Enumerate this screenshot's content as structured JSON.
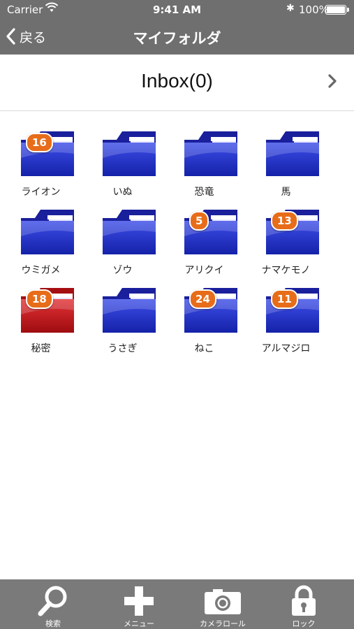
{
  "status_bar": {
    "carrier": "Carrier",
    "time": "9:41 AM",
    "battery": "100%"
  },
  "nav": {
    "back_label": "戻る",
    "title": "マイフォルダ"
  },
  "inbox": {
    "label": "Inbox(0)"
  },
  "folders": [
    {
      "name": "ライオン",
      "badge": "16",
      "color": "blue"
    },
    {
      "name": "いぬ",
      "badge": "",
      "color": "blue"
    },
    {
      "name": "恐竜",
      "badge": "",
      "color": "blue"
    },
    {
      "name": "馬",
      "badge": "",
      "color": "blue"
    },
    {
      "name": "ウミガメ",
      "badge": "",
      "color": "blue"
    },
    {
      "name": "ゾウ",
      "badge": "",
      "color": "blue"
    },
    {
      "name": "アリクイ",
      "badge": "5",
      "color": "blue"
    },
    {
      "name": "ナマケモノ",
      "badge": "13",
      "color": "blue"
    },
    {
      "name": "秘密",
      "badge": "18",
      "color": "red"
    },
    {
      "name": "うさぎ",
      "badge": "",
      "color": "blue"
    },
    {
      "name": "ねこ",
      "badge": "24",
      "color": "blue"
    },
    {
      "name": "アルマジロ",
      "badge": "11",
      "color": "blue"
    }
  ],
  "tabbar": {
    "items": [
      {
        "label": "検索",
        "icon": "search-icon"
      },
      {
        "label": "メニュー",
        "icon": "plus-icon"
      },
      {
        "label": "カメラロール",
        "icon": "camera-icon"
      },
      {
        "label": "ロック",
        "icon": "lock-icon"
      }
    ]
  },
  "colors": {
    "bar_gray": "#6f6f6f",
    "tab_gray": "#7a7a7a",
    "folder_blue": "#1e2fc4",
    "folder_red": "#c4161c",
    "badge_orange": "#e76d1a"
  }
}
